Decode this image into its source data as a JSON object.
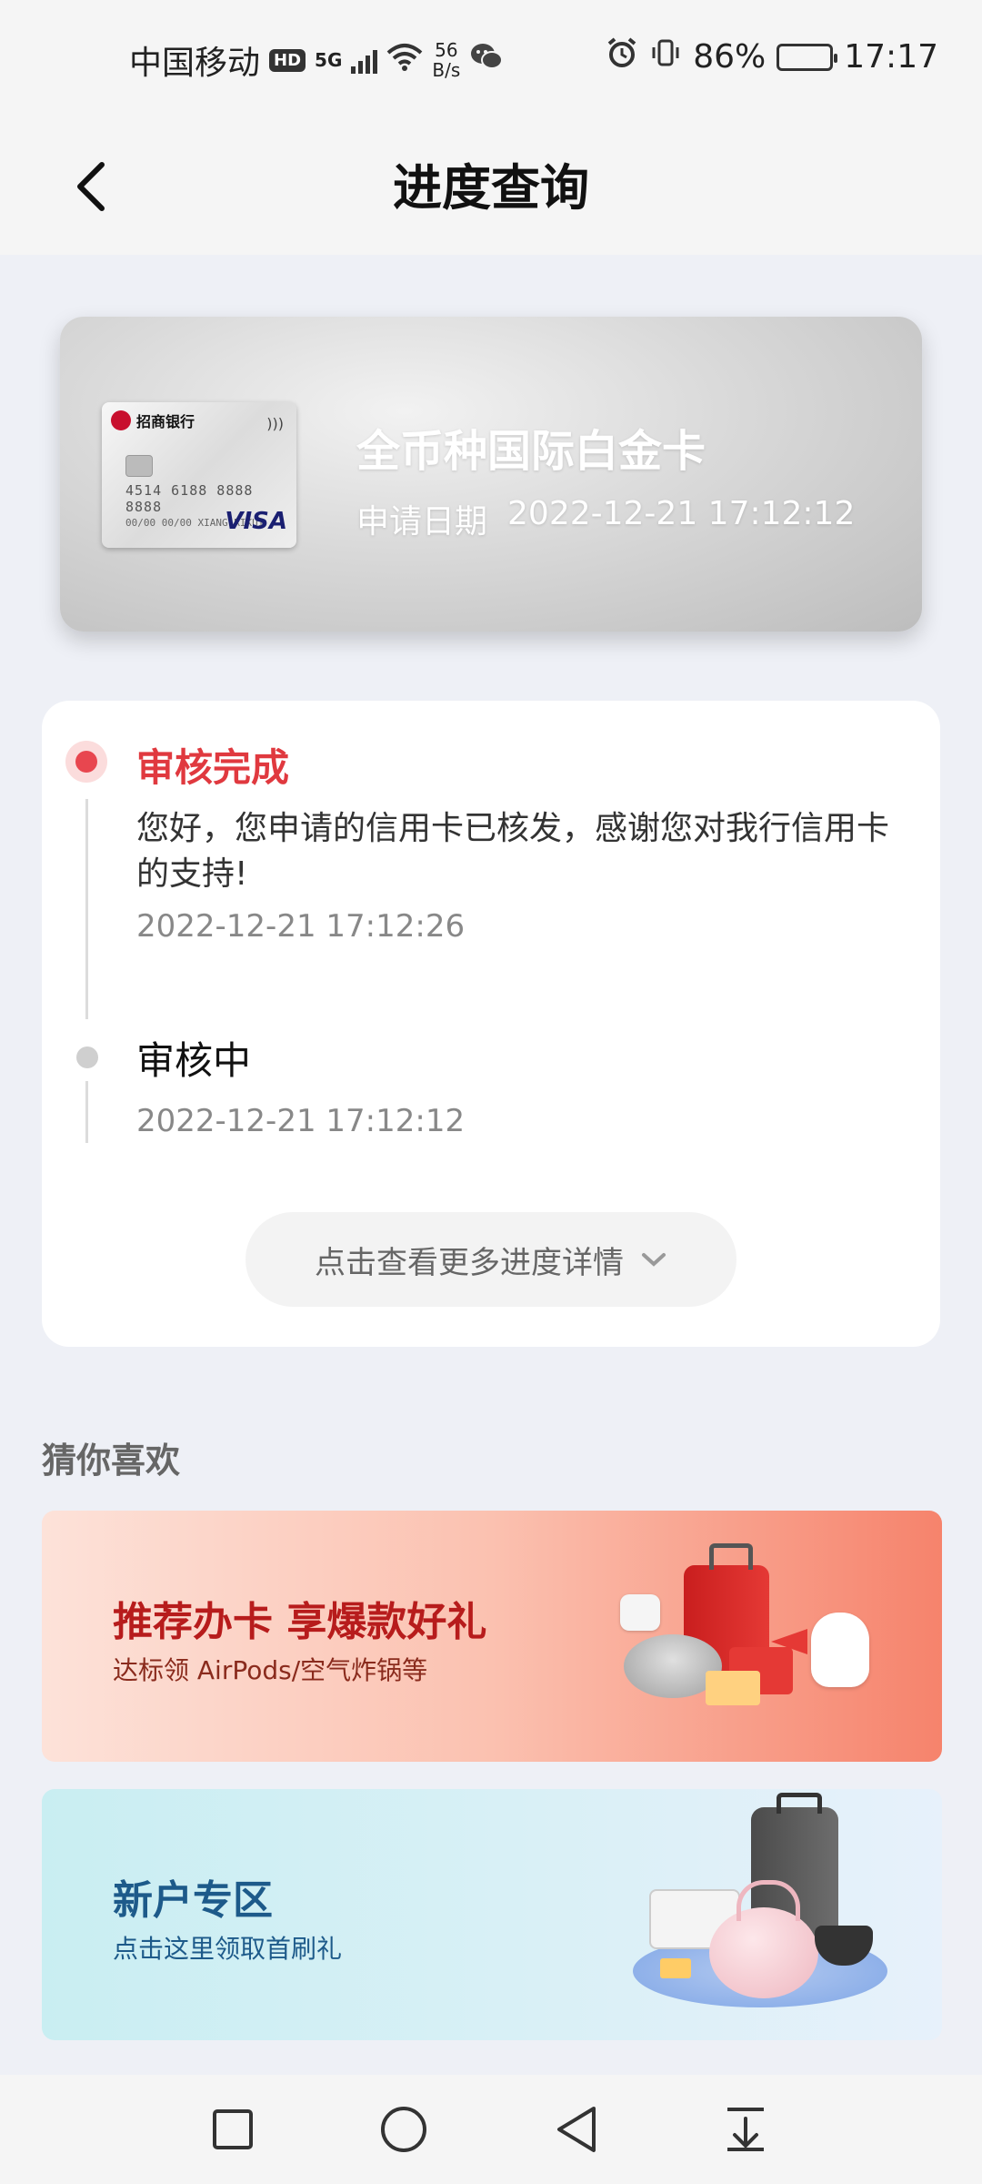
{
  "status_bar": {
    "carrier": "中国移动",
    "hd_badge": "HD",
    "network": "5G",
    "speed_value": "56",
    "speed_unit": "B/s",
    "battery": "86%",
    "time": "17:17"
  },
  "header": {
    "title": "进度查询"
  },
  "card": {
    "bank_name": "招商银行",
    "card_number": "4514 6188 8888 8888",
    "card_holder": "00/00  00/00  XIANG RIKUI",
    "network_brand": "VISA",
    "name": "全币种国际白金卡",
    "apply_date_label": "申请日期",
    "apply_date_value": "2022-12-21 17:12:12"
  },
  "progress": {
    "steps": [
      {
        "title": "审核完成",
        "description": "您好，您申请的信用卡已核发，感谢您对我行信用卡的支持!",
        "time": "2022-12-21 17:12:26"
      },
      {
        "title": "审核中",
        "time": "2022-12-21 17:12:12"
      }
    ],
    "more_label": "点击查看更多进度详情"
  },
  "recommend": {
    "section_title": "猜你喜欢",
    "banners": [
      {
        "title": "推荐办卡 享爆款好礼",
        "subtitle": "达标领 AirPods/空气炸锅等"
      },
      {
        "title": "新户专区",
        "subtitle": "点击这里领取首刷礼"
      }
    ]
  },
  "colors": {
    "accent_red": "#e0393f",
    "background": "#eef0f6"
  }
}
